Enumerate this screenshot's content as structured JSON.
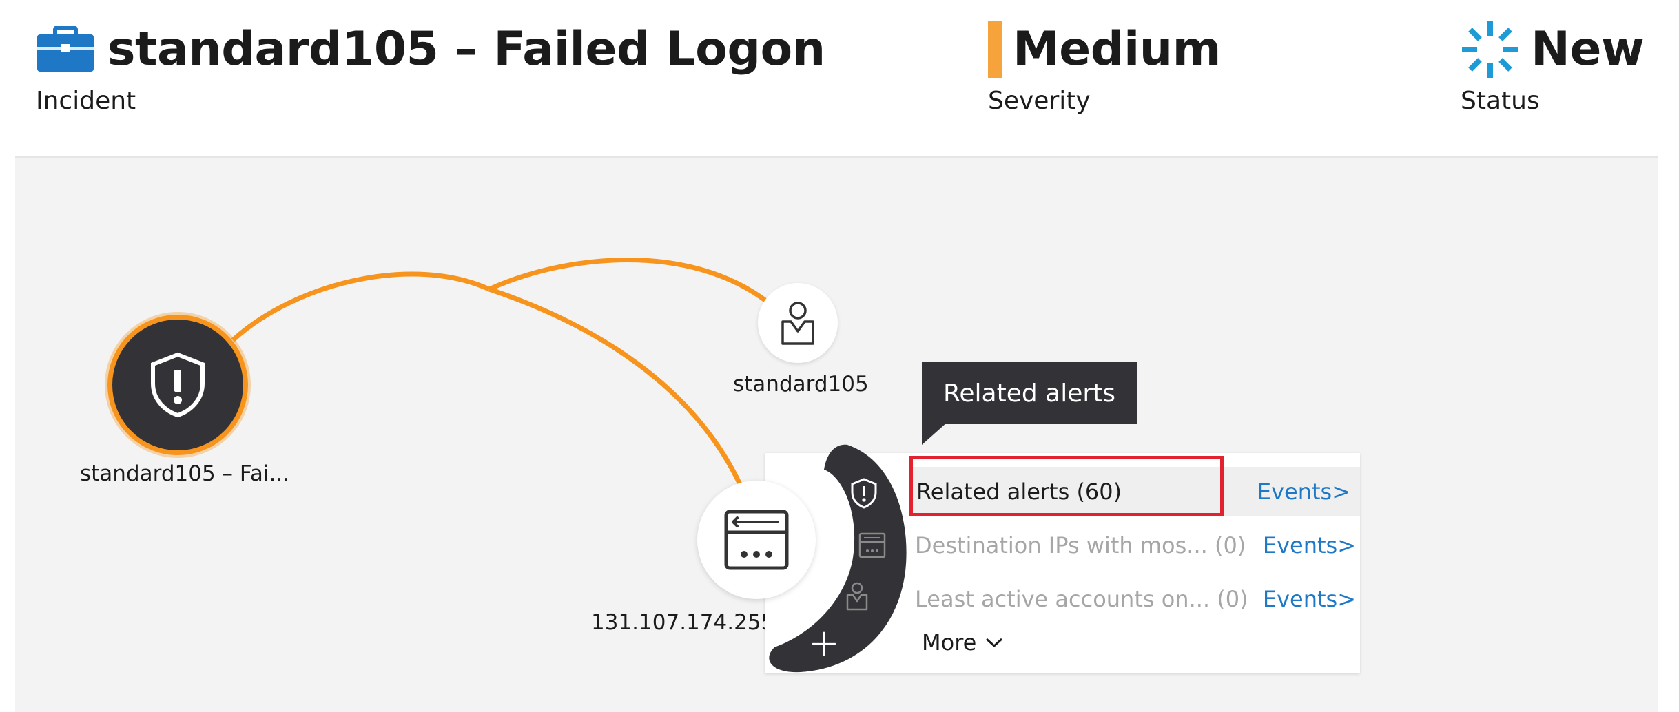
{
  "header": {
    "incident": {
      "title": "standard105 – Failed Logon",
      "label": "Incident",
      "icon": "briefcase-icon"
    },
    "severity": {
      "value": "Medium",
      "label": "Severity",
      "color": "#f7a33b"
    },
    "status": {
      "value": "New",
      "label": "Status",
      "icon": "status-spinner-icon",
      "color": "#1e9bd7"
    }
  },
  "graph": {
    "edge_color": "#f6941d",
    "nodes": {
      "alert": {
        "label": "standard105 – Fai...",
        "icon": "shield-alert-icon"
      },
      "user": {
        "label": "standard105",
        "icon": "user-account-icon"
      },
      "ip": {
        "label": "131.107.174.255",
        "icon": "ip-window-icon"
      }
    }
  },
  "tooltip": {
    "text": "Related alerts"
  },
  "menu": {
    "items": [
      {
        "label": "Related alerts (60)",
        "events": "Events>",
        "icon": "shield-alert-icon"
      },
      {
        "label": "Destination IPs with mos... (0)",
        "events": "Events>",
        "icon": "ip-window-icon"
      },
      {
        "label": "Least active accounts on... (0)",
        "events": "Events>",
        "icon": "user-account-icon"
      }
    ],
    "more_label": "More",
    "add_icon": "plus-icon",
    "link_color": "#1e78c6"
  }
}
